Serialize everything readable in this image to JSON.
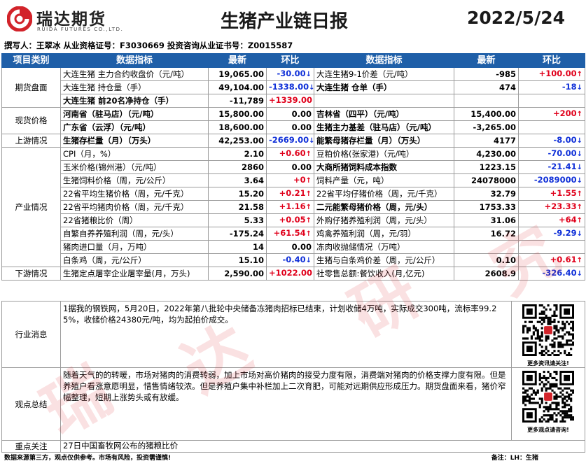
{
  "brand": {
    "name_cn": "瑞达期货",
    "name_en": "RUIDA FUTURES CO.,LTD.",
    "color": "#d2232a"
  },
  "report": {
    "title": "生猪产业链日报",
    "date": "2022/5/24"
  },
  "author_line": "撰写人：王翠冰   从业资格证号：F3030669   投资咨询从业证书号：Z0015587",
  "columns": {
    "category": "项目类别",
    "indicator": "数据指标",
    "latest": "最新",
    "change": "环比"
  },
  "rows": [
    {
      "cat": "期货盘面",
      "l": {
        "name": "大连生猪 主力合约收盘价（元/吨）",
        "val": "19,065.00",
        "chg": "-30.00",
        "dir": "down"
      },
      "r": {
        "name": "大连生猪9-1价差（元/吨）",
        "val": "-985",
        "chg": "+100.00",
        "dir": "up"
      }
    },
    {
      "l": {
        "name": "大连生猪 持仓量（手）",
        "val": "49,104.00",
        "chg": "-1338.00",
        "dir": "down"
      },
      "r": {
        "name": "大连生猪 仓单（手）",
        "val": "474",
        "chg": "-18",
        "dir": "down",
        "bold": true
      }
    },
    {
      "l": {
        "name": "大连生猪 前20名净持仓（手）",
        "val": "-11,789",
        "chg": "+1339.00",
        "dir": "up",
        "bold": true
      },
      "r": {
        "name": "",
        "val": "",
        "chg": "",
        "dir": ""
      }
    },
    {
      "cat": "现货价格",
      "l": {
        "name": "河南省（驻马店）（元/吨）",
        "val": "15,800.00",
        "chg": "0.00",
        "dir": "flat",
        "bold": true
      },
      "r": {
        "name": "吉林省（四平）（元/吨）",
        "val": "15,400.00",
        "chg": "+200",
        "dir": "up",
        "bold": true
      }
    },
    {
      "l": {
        "name": "广东省（云浮）（元/吨）",
        "val": "18,600.00",
        "chg": "0.00",
        "dir": "flat",
        "bold": true
      },
      "r": {
        "name": "生猪主力基差（驻马店）（元/吨）",
        "val": "-3,265.00",
        "chg": "",
        "dir": "",
        "bold": true
      }
    },
    {
      "cat": "上游情况",
      "l": {
        "name": "生猪存栏量（月）（万头）",
        "val": "42,253.00",
        "chg": "-2669.00",
        "dir": "down",
        "bold": true
      },
      "r": {
        "name": "能繁母猪存栏量（月）（万头）",
        "val": "4177",
        "chg": "-8.00",
        "dir": "down",
        "bold": true
      }
    },
    {
      "cat": "产业情况",
      "l": {
        "name": "CPI（月，%）",
        "val": "2.10",
        "chg": "+0.60",
        "dir": "up"
      },
      "r": {
        "name": "豆粕价格(张家港)（元/吨）",
        "val": "4,230.00",
        "chg": "-70.00",
        "dir": "down"
      }
    },
    {
      "l": {
        "name": "玉米价格(锦州港）（元/吨）",
        "val": "2860",
        "chg": "0.00",
        "dir": "flat"
      },
      "r": {
        "name": "大商所猪饲料成本指数",
        "val": "1223.15",
        "chg": "-21.41",
        "dir": "down",
        "bold": true
      }
    },
    {
      "l": {
        "name": "生猪饲料价格（周，元/公斤）",
        "val": "3.64",
        "chg": "+0",
        "dir": "up"
      },
      "r": {
        "name": "饲料产量（元，吨）",
        "val": "24078000",
        "chg": "-2089000",
        "dir": "down"
      }
    },
    {
      "l": {
        "name": "22省平均生猪价格（周，元/千克）",
        "val": "15.20",
        "chg": "+0.21",
        "dir": "up"
      },
      "r": {
        "name": "22省平均仔猪价格（周，元/千克）",
        "val": "32.79",
        "chg": "+1.55",
        "dir": "up"
      }
    },
    {
      "l": {
        "name": "22省平均猪肉价格（周，元/千克）",
        "val": "21.58",
        "chg": "+1.16",
        "dir": "up"
      },
      "r": {
        "name": "二元能繁母猪价格（周，元/头）",
        "val": "1753.33",
        "chg": "+23.33",
        "dir": "up",
        "bold": true
      }
    },
    {
      "l": {
        "name": "22省猪粮比价（周）",
        "val": "5.33",
        "chg": "+0.05",
        "dir": "up"
      },
      "r": {
        "name": "外购仔猪养殖利润（周，元/头）",
        "val": "31.06",
        "chg": "+64",
        "dir": "up"
      }
    },
    {
      "l": {
        "name": "自繁自养养殖利润（周，元/头）",
        "val": "-175.24",
        "chg": "+61.54",
        "dir": "up"
      },
      "r": {
        "name": "鸡禽养殖利润（周，元/羽）",
        "val": "16.72",
        "chg": "-9.29",
        "dir": "down"
      }
    },
    {
      "l": {
        "name": "猪肉进口量（月，万吨）",
        "val": "14",
        "chg": "0.00",
        "dir": "flat"
      },
      "r": {
        "name": "冻肉收抛储情况（万吨）",
        "val": "",
        "chg": "",
        "dir": ""
      }
    },
    {
      "l": {
        "name": "白条鸡（周，元/公斤）",
        "val": "15.10",
        "chg": "-0.40",
        "dir": "down"
      },
      "r": {
        "name": "生猪与白条鸡价差（周，元/公斤）",
        "val": "0.10",
        "chg": "+0.61",
        "dir": "up"
      }
    },
    {
      "cat": "下游情况",
      "l": {
        "name": "生猪定点屠宰企业屠宰量(月，万头)",
        "val": "2,590.00",
        "chg": "+1022.00",
        "dir": "up"
      },
      "r": {
        "name": "社零售总额:餐饮收入(月,亿元)",
        "val": "2608.9",
        "chg": "-326.40",
        "dir": "down"
      }
    }
  ],
  "sections": {
    "industry_news": {
      "label": "行业消息",
      "text": "1据我的钢铁网，5月20日，2022年第八批轮中央储备冻猪肉招标已结束，计划收储4万吨，实际成交300吨，流标率99.25%，收储价格24380元/吨，均为起拍价成交。",
      "qr_caption": "更多资讯请关注!"
    },
    "opinion": {
      "label": "观点总结",
      "text": "随着天气的的转暖，市场对猪肉的消费转弱，加上市场对高价猪肉的接受力度有限，消费端对猪肉的价格支撑力度有限。但是养殖户看涨意愿明显，惜售情绪较浓。但是养殖户集中补栏加上二次育肥，可能对远期供应形成压力。期货盘面来看，猪价窄幅整理，短期上涨势头或有放缓。",
      "qr_caption": "更多观点请咨询!"
    },
    "focus": {
      "label": "重点关注",
      "text": "27日中国畜牧网公布的猪粮比价"
    }
  },
  "footer": {
    "left": "数据来源第三方，观点仅供参考。市场有风险，投资需谨慎!",
    "right": "备注：LH：生猪"
  },
  "watermark": {
    "chars": [
      "瑞",
      "达",
      "研",
      "究"
    ]
  },
  "colors": {
    "header_bg": "#1f5fa8",
    "up": "#e0001b",
    "down": "#1030d8"
  }
}
